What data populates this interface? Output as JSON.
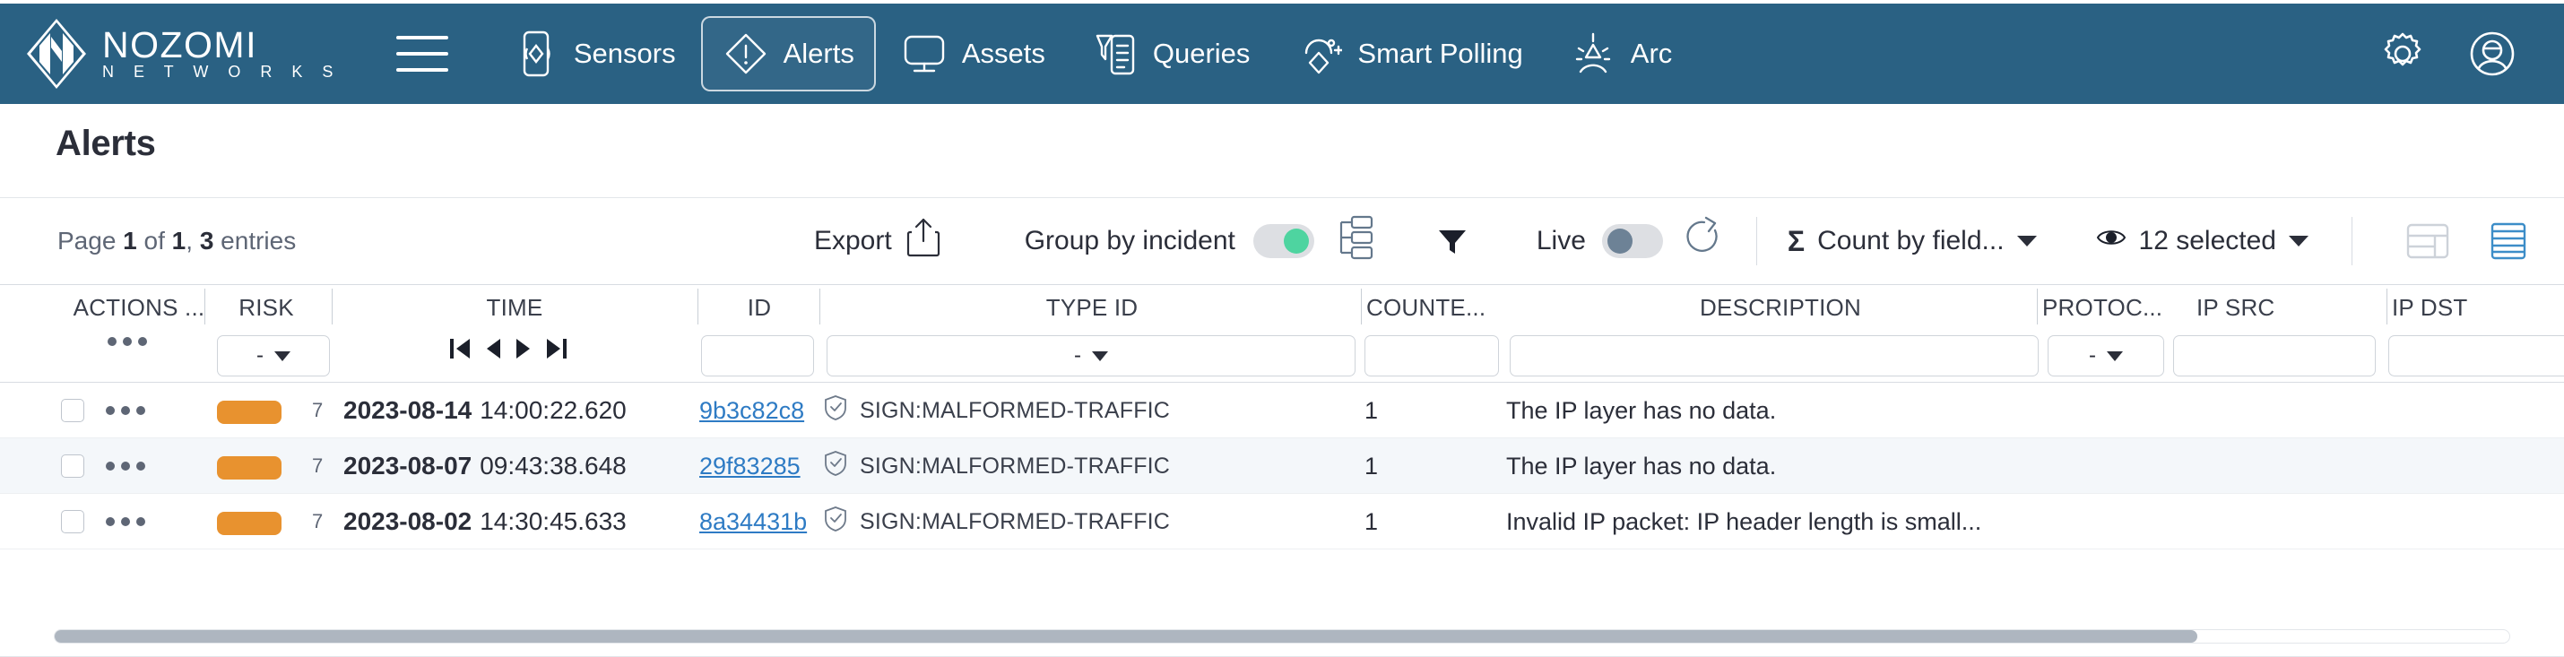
{
  "brand": {
    "name": "NOZOMI",
    "sub": "N E T W O R K S"
  },
  "nav": {
    "items": [
      {
        "label": "Sensors",
        "icon": "sensors-icon",
        "active": false
      },
      {
        "label": "Alerts",
        "icon": "alerts-icon",
        "active": true
      },
      {
        "label": "Assets",
        "icon": "assets-icon",
        "active": false
      },
      {
        "label": "Queries",
        "icon": "queries-icon",
        "active": false
      },
      {
        "label": "Smart Polling",
        "icon": "smart-polling-icon",
        "active": false
      },
      {
        "label": "Arc",
        "icon": "arc-icon",
        "active": false
      }
    ],
    "right_icons": [
      "gear-icon",
      "user-account-icon"
    ]
  },
  "page": {
    "title": "Alerts",
    "entries_prefix": "Page ",
    "entries_page": "1",
    "entries_mid": " of ",
    "entries_total_pages": "1",
    "entries_comma": ", ",
    "entries_count": "3",
    "entries_suffix": " entries"
  },
  "toolbar": {
    "export_label": "Export",
    "group_by_label": "Group by incident",
    "group_by_on": true,
    "live_label": "Live",
    "live_on": false,
    "count_by_field_label": "Count by field...",
    "count_sigma": "Σ",
    "selected_label": "12 selected"
  },
  "table": {
    "columns": [
      {
        "key": "actions",
        "label": "ACTIONS ...",
        "filter": "dots"
      },
      {
        "key": "risk",
        "label": "RISK",
        "filter": "select",
        "filter_value": "-"
      },
      {
        "key": "time",
        "label": "TIME",
        "filter": "pager"
      },
      {
        "key": "id",
        "label": "ID",
        "filter": "text",
        "filter_value": ""
      },
      {
        "key": "type_id",
        "label": "TYPE ID",
        "filter": "select",
        "filter_value": "-"
      },
      {
        "key": "counter",
        "label": "COUNTE...",
        "filter": "text",
        "filter_value": ""
      },
      {
        "key": "description",
        "label": "DESCRIPTION",
        "filter": "text",
        "filter_value": ""
      },
      {
        "key": "protocol",
        "label": "PROTOC...",
        "filter": "select",
        "filter_value": "-"
      },
      {
        "key": "ip_src",
        "label": "IP SRC",
        "filter": "text",
        "filter_value": ""
      },
      {
        "key": "ip_dst",
        "label": "IP DST",
        "filter": "text",
        "filter_value": ""
      }
    ],
    "rows": [
      {
        "risk_color": "#E8922F",
        "risk_value": "7",
        "date": "2023-08-14",
        "time": "14:00:22.620",
        "id": "9b3c82c8",
        "type_id": "SIGN:MALFORMED-TRAFFIC",
        "counter": "1",
        "description": "The IP layer has no data."
      },
      {
        "risk_color": "#E8922F",
        "risk_value": "7",
        "date": "2023-08-07",
        "time": "09:43:38.648",
        "id": "29f83285",
        "type_id": "SIGN:MALFORMED-TRAFFIC",
        "counter": "1",
        "description": "The IP layer has no data."
      },
      {
        "risk_color": "#E8922F",
        "risk_value": "7",
        "date": "2023-08-02",
        "time": "14:30:45.633",
        "id": "8a34431b",
        "type_id": "SIGN:MALFORMED-TRAFFIC",
        "counter": "1",
        "description": "Invalid IP packet: IP header length is small..."
      }
    ]
  },
  "colors": {
    "header_bg": "#2A6183",
    "risk_orange": "#E8922F",
    "link_blue": "#2E7BC4",
    "toggle_on": "#4ED4A0",
    "accent_selected": "#3C8DC8"
  }
}
